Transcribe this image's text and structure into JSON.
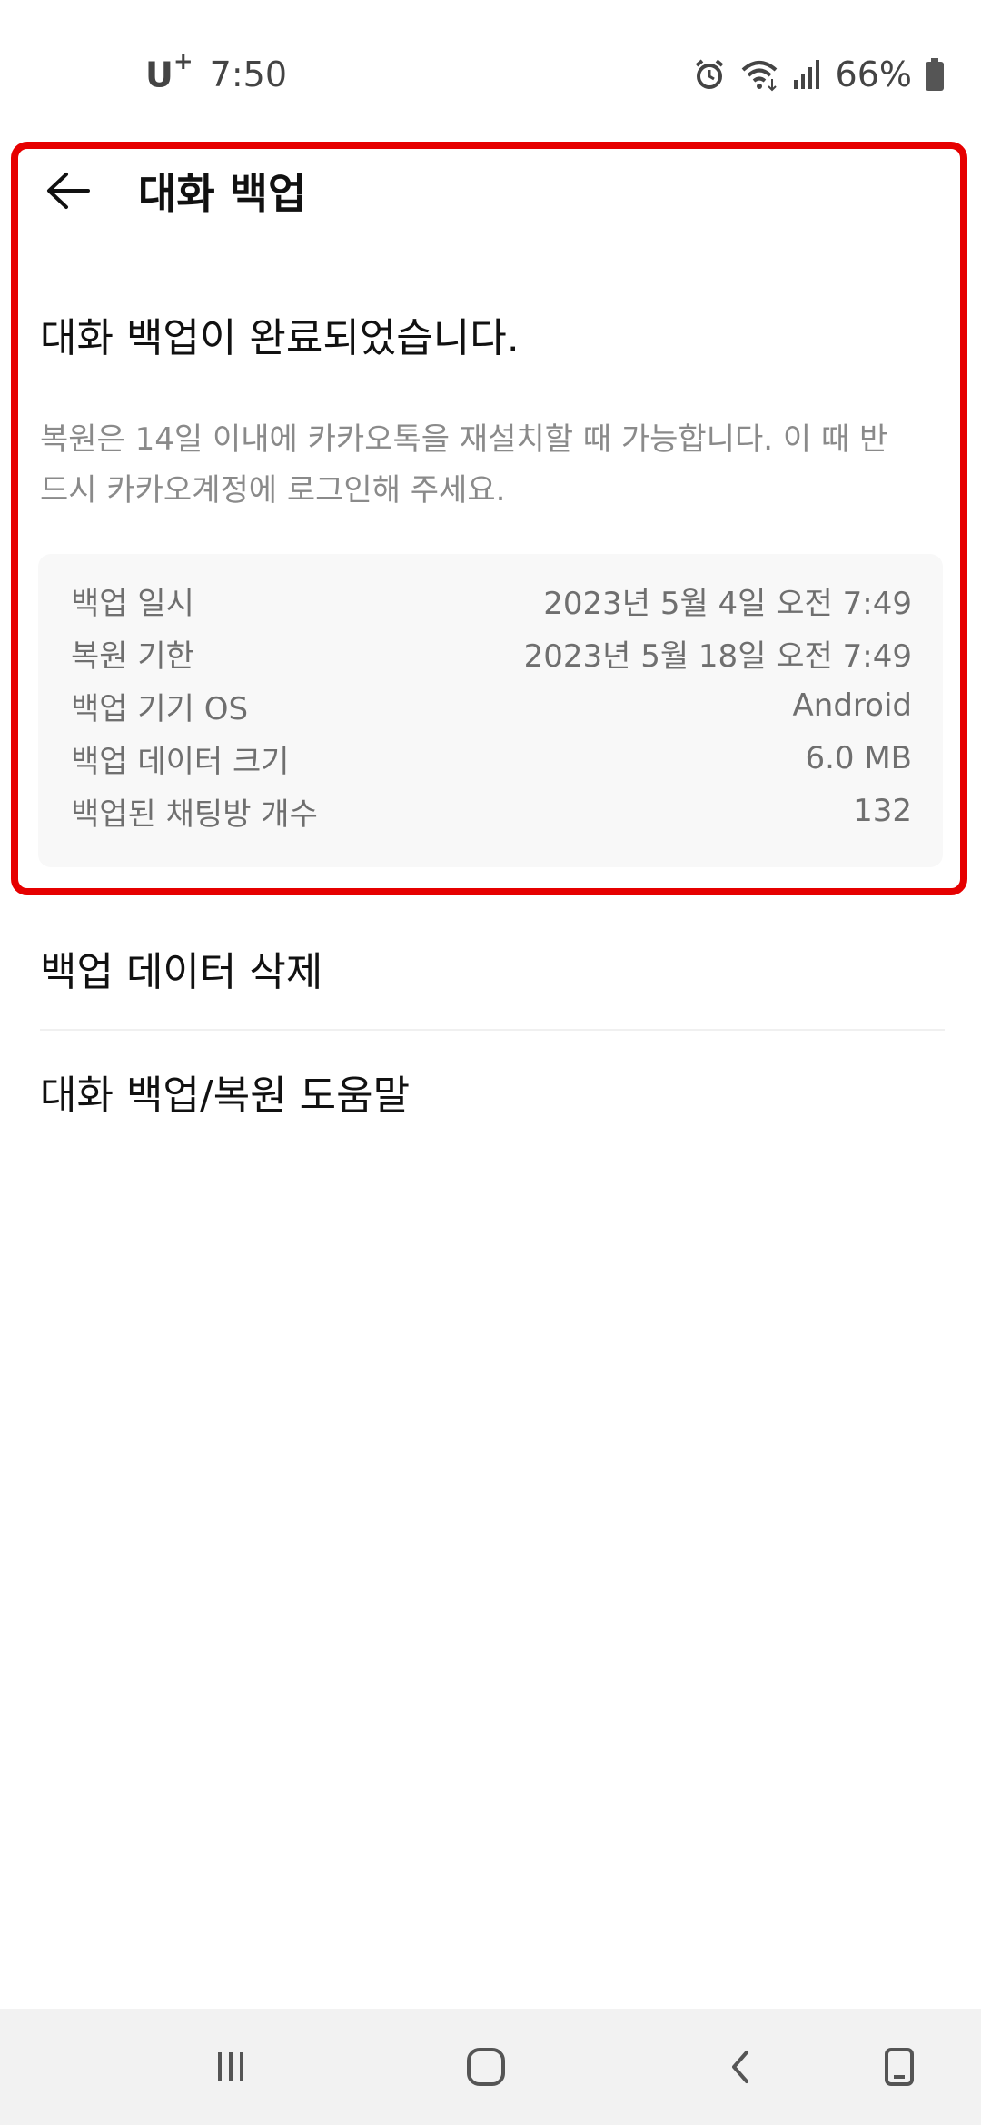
{
  "status_bar": {
    "carrier": "U",
    "carrier_sup": "+",
    "time": "7:50",
    "battery": "66%",
    "icons": [
      "alarm-icon",
      "wifi-icon",
      "signal-icon",
      "battery-icon"
    ]
  },
  "header": {
    "title": "대화 백업",
    "back_icon": "arrow-left-icon"
  },
  "main": {
    "completed_title": "대화 백업이 완료되었습니다.",
    "description": "복원은 14일 이내에 카카오톡을 재설치할 때 가능합니다. 이 때 반드시 카카오계정에 로그인해 주세요.",
    "info": [
      {
        "label": "백업 일시",
        "value": "2023년 5월 4일 오전 7:49"
      },
      {
        "label": "복원 기한",
        "value": "2023년 5월 18일 오전 7:49"
      },
      {
        "label": "백업 기기 OS",
        "value": "Android"
      },
      {
        "label": "백업 데이터 크기",
        "value": "6.0 MB"
      },
      {
        "label": "백업된 채팅방 개수",
        "value": "132"
      }
    ]
  },
  "menu": {
    "delete_backup": "백업 데이터 삭제",
    "help": "대화 백업/복원 도움말"
  },
  "nav_bar": {
    "icons": [
      "recents-icon",
      "home-icon",
      "back-icon",
      "assist-icon"
    ]
  },
  "colors": {
    "highlight": "#e60000",
    "card_bg": "#f8f8f8",
    "muted_text": "#8a8a8a"
  }
}
